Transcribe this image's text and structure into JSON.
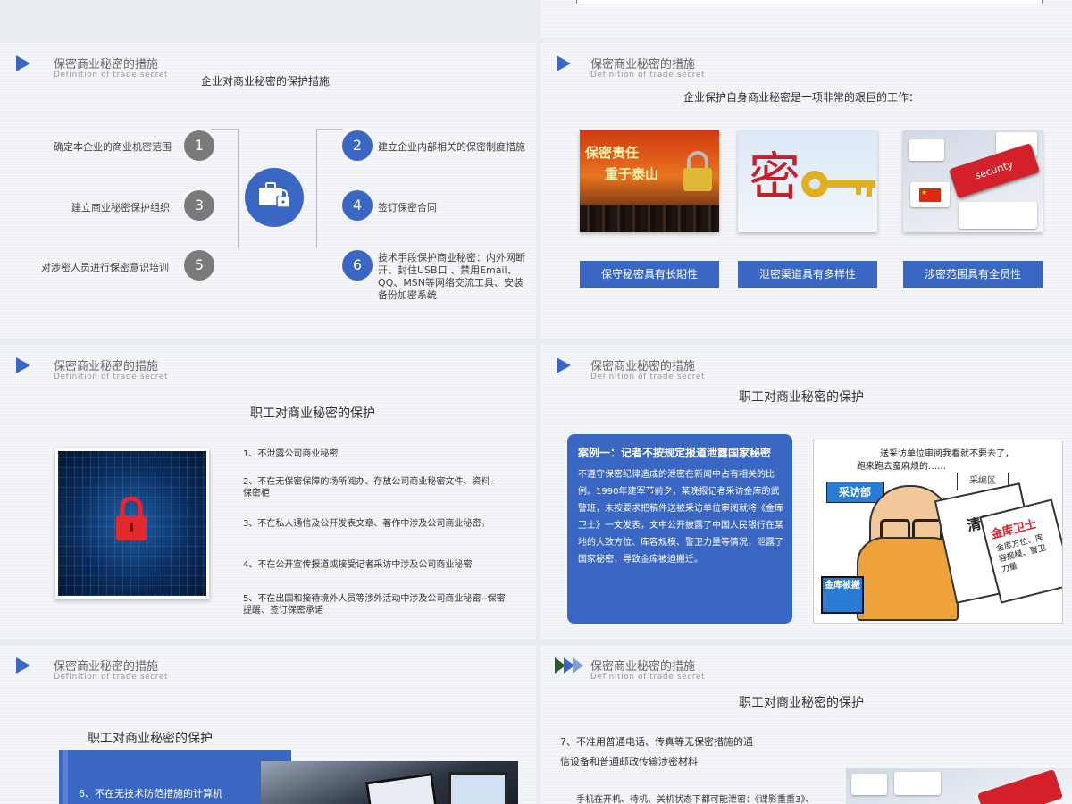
{
  "common": {
    "header_title": "保密商业秘密的措施",
    "header_sub": "Definition of trade secret"
  },
  "slide1": {
    "subtitle": "企业对商业秘密的保护措施",
    "items": [
      {
        "num": "1",
        "text": "确定本企业的商业机密范围"
      },
      {
        "num": "2",
        "text": "建立企业内部相关的保密制度措施"
      },
      {
        "num": "3",
        "text": "建立商业秘密保护组织"
      },
      {
        "num": "4",
        "text": "签订保密合同"
      },
      {
        "num": "5",
        "text": "对涉密人员进行保密意识培训"
      },
      {
        "num": "6",
        "text": "技术手段保护商业秘密：内外网断开、封住USB口 、禁用Email、QQ、MSN等网络交流工具、安装备份加密系统"
      }
    ]
  },
  "slide2": {
    "subtitle": "企业保护自身商业秘密是一项非常的艰巨的工作：",
    "image1_text1": "保密责任",
    "image1_text2": "重于泰山",
    "image2_text": "密",
    "image3_text": "security",
    "labels": [
      "保守秘密具有长期性",
      "泄密渠道具有多样性",
      "涉密范围具有全员性"
    ]
  },
  "slide3": {
    "subtitle": "职工对商业秘密的保护",
    "items": [
      "1、不泄露公司商业秘密",
      "2、不在无保密保障的场所阅办、存放公司商业秘密文件、资料—保密柜",
      "3、不在私人通信及公开发表文章、著作中涉及公司商业秘密。",
      "4、不在公开宣传报道或接受记者采访中涉及公司商业秘密",
      "5、不在出国和接待境外人员等涉外活动中涉及公司商业秘密--保密提醒、签订保密承诺"
    ]
  },
  "slide4": {
    "subtitle": "职工对商业秘密的保护",
    "case_title": "案例一：记者不按规定报道泄露国家秘密",
    "case_body": "不遵守保密纪律造成的泄密在新闻中占有相关的比例。1990年建军节前夕，某晚报记者采访金库的武警班，未按要求把稿件送被采访单位审阅就将《金库卫士》一文发表，文中公开披露了中国人民银行在某地的大致方位、库容规模、警卫力量等情况，泄露了国家秘密，导致金库被迫搬迁。",
    "cartoon_caption1": "送采访单位审阅我看就不要去了，",
    "cartoon_caption2": "跑来跑去蛮麻烦的……",
    "cartoon_tag": "采访部",
    "cartoon_paper1": "清样",
    "cartoon_paper2": "金库卫士",
    "cartoon_paper3": "金库方位、库容规模、警卫力量",
    "cartoon_badge": "金库被搬",
    "cartoon_sign": "采编区"
  },
  "slide5": {
    "subtitle": "职工对商业秘密的保护",
    "item6": "6、不在无技术防范措施的计算机"
  },
  "slide6": {
    "subtitle": "职工对商业秘密的保护",
    "item7_line1": "7、不准用普通电话、传真等无保密措施的通",
    "item7_line2": "信设备和普通邮政传输涉密材料",
    "note": "手机在开机、待机、关机状态下都可能泄密：《谍影重重3》、"
  }
}
